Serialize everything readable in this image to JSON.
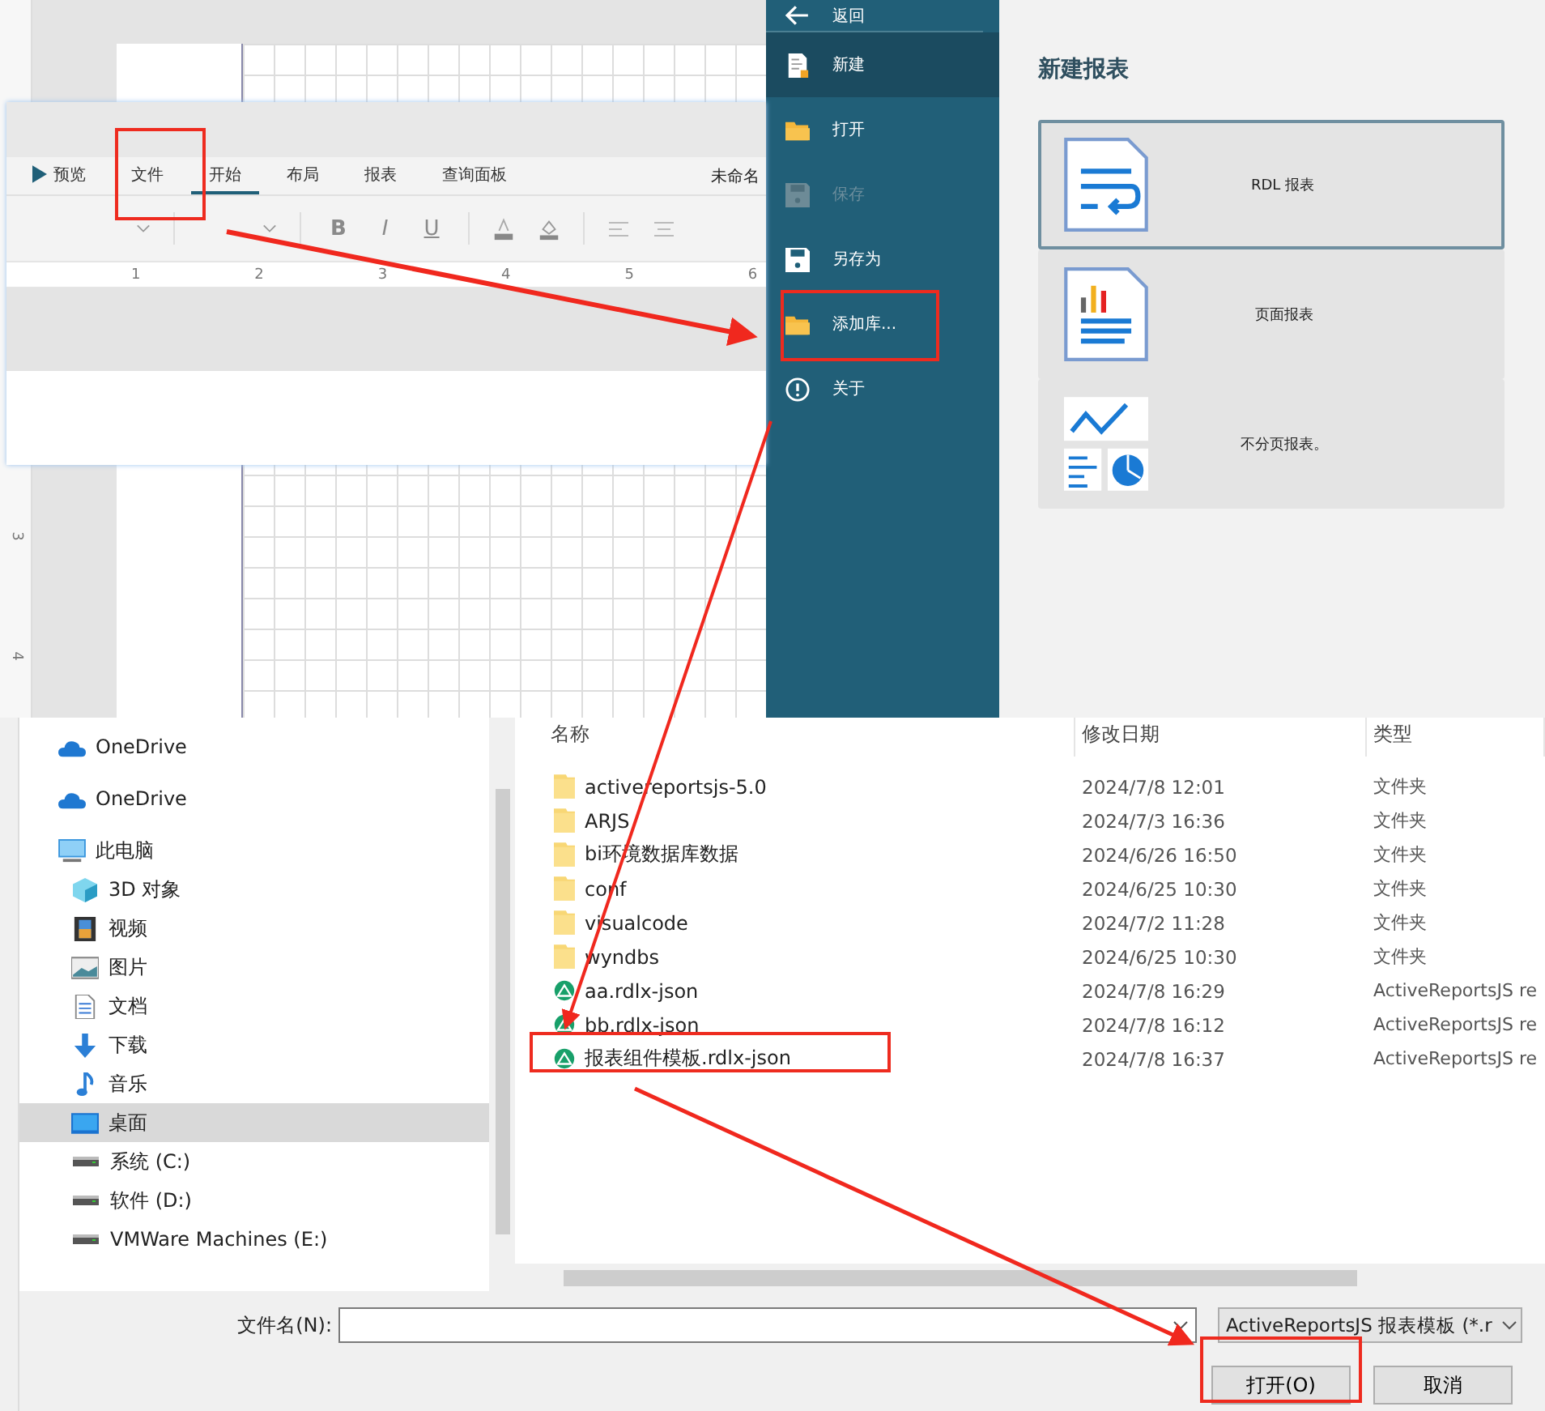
{
  "designer": {
    "tabs": [
      {
        "label": "预览",
        "kind": "preview",
        "selected": false
      },
      {
        "label": "文件",
        "kind": "tab",
        "selected": false
      },
      {
        "label": "开始",
        "kind": "tab",
        "selected": true
      },
      {
        "label": "布局",
        "kind": "tab",
        "selected": false
      },
      {
        "label": "报表",
        "kind": "tab",
        "selected": false
      },
      {
        "label": "查询面板",
        "kind": "tab",
        "selected": false
      }
    ],
    "doc_title": "未命名",
    "format_buttons": [
      "B",
      "I",
      "U"
    ],
    "ruler": [
      "1",
      "2",
      "3",
      "4",
      "5",
      "6"
    ],
    "vertical_ruler": [
      "3",
      "4"
    ]
  },
  "file_menu": [
    {
      "label": "返回",
      "kind": "back",
      "selected": false,
      "disabled": false
    },
    {
      "label": "新建",
      "kind": "new",
      "selected": true,
      "disabled": false
    },
    {
      "label": "打开",
      "kind": "open",
      "selected": false,
      "disabled": false
    },
    {
      "label": "保存",
      "kind": "save",
      "selected": false,
      "disabled": true
    },
    {
      "label": "另存为",
      "kind": "save",
      "selected": false,
      "disabled": false
    },
    {
      "label": "添加库...",
      "kind": "open",
      "selected": false,
      "disabled": false
    },
    {
      "label": "关于",
      "kind": "about",
      "selected": false,
      "disabled": false
    }
  ],
  "new_report": {
    "title": "新建报表",
    "cards": [
      {
        "label": "RDL 报表",
        "kind": "rdl",
        "selected": true
      },
      {
        "label": "页面报表",
        "kind": "page",
        "selected": false
      },
      {
        "label": "不分页报表。",
        "kind": "continuous",
        "selected": false
      }
    ]
  },
  "open_dialog": {
    "nav": [
      {
        "label": "OneDrive",
        "kind": "cloud",
        "selected": false
      },
      {
        "label": "OneDrive",
        "kind": "cloud",
        "selected": false
      },
      {
        "label": "此电脑",
        "kind": "pc",
        "selected": false,
        "children": [
          {
            "label": "3D 对象",
            "kind": "cube",
            "selected": false
          },
          {
            "label": "视频",
            "kind": "video",
            "selected": false
          },
          {
            "label": "图片",
            "kind": "image",
            "selected": false
          },
          {
            "label": "文档",
            "kind": "doc",
            "selected": false
          },
          {
            "label": "下载",
            "kind": "download",
            "selected": false
          },
          {
            "label": "音乐",
            "kind": "music",
            "selected": false
          },
          {
            "label": "桌面",
            "kind": "desktop",
            "selected": true
          },
          {
            "label": "系统 (C:)",
            "kind": "drive",
            "selected": false
          },
          {
            "label": "软件 (D:)",
            "kind": "drive",
            "selected": false
          },
          {
            "label": "VMWare Machines (E:)",
            "kind": "drive",
            "selected": false
          }
        ]
      }
    ],
    "columns": [
      "名称",
      "修改日期",
      "类型"
    ],
    "rows": [
      {
        "name": "activereportsjs-5.0",
        "date": "2024/7/8 12:01",
        "type": "文件夹",
        "kind": "folder"
      },
      {
        "name": "ARJS",
        "date": "2024/7/3 16:36",
        "type": "文件夹",
        "kind": "folder"
      },
      {
        "name": "bi环境数据库数据",
        "date": "2024/6/26 16:50",
        "type": "文件夹",
        "kind": "folder"
      },
      {
        "name": "conf",
        "date": "2024/6/25 10:30",
        "type": "文件夹",
        "kind": "folder"
      },
      {
        "name": "visualcode",
        "date": "2024/7/2 11:28",
        "type": "文件夹",
        "kind": "folder"
      },
      {
        "name": "wyndbs",
        "date": "2024/6/25 10:30",
        "type": "文件夹",
        "kind": "folder"
      },
      {
        "name": "aa.rdlx-json",
        "date": "2024/7/8 16:29",
        "type": "ActiveReportsJS re",
        "kind": "report"
      },
      {
        "name": "bb.rdlx-json",
        "date": "2024/7/8 16:12",
        "type": "ActiveReportsJS re",
        "kind": "report"
      },
      {
        "name": "报表组件模板.rdlx-json",
        "date": "2024/7/8 16:37",
        "type": "ActiveReportsJS re",
        "kind": "report"
      }
    ],
    "filename_label": "文件名(N):",
    "file_type": "ActiveReportsJS 报表模板 (*.r",
    "buttons": [
      "打开(O)",
      "取消"
    ]
  }
}
